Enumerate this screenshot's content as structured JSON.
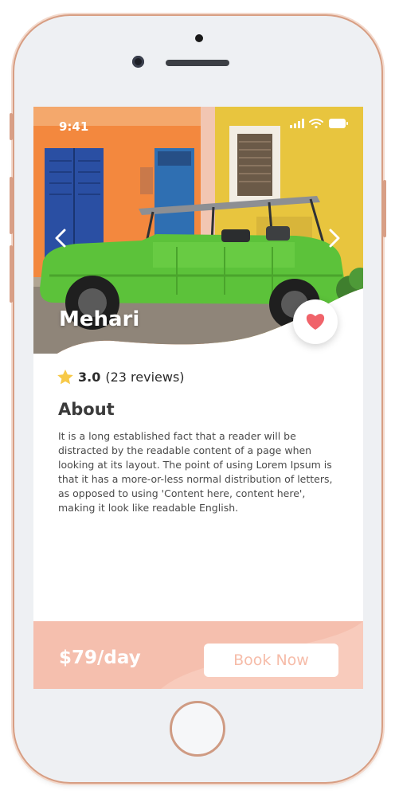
{
  "status_bar": {
    "time": "9:41"
  },
  "car": {
    "name": "Mehari",
    "rating": "3.0",
    "reviews": "(23 reviews)"
  },
  "about": {
    "title": "About",
    "text": "It is a long established fact that a reader will be distracted by the readable content of a page when looking at its layout. The point of using Lorem Ipsum is that it has a more-or-less normal distribution of letters, as opposed to using 'Content here, content here', making it look like readable English."
  },
  "booking": {
    "price": "$79/day",
    "button_label": "Book Now"
  },
  "icons": {
    "prev": "chevron-left-icon",
    "next": "chevron-right-icon",
    "favorite": "heart-icon",
    "rating": "star-icon"
  },
  "colors": {
    "accent": "#f5bfae",
    "heart": "#f0636a",
    "star": "#f7c948",
    "button_text": "#f6bca9"
  }
}
